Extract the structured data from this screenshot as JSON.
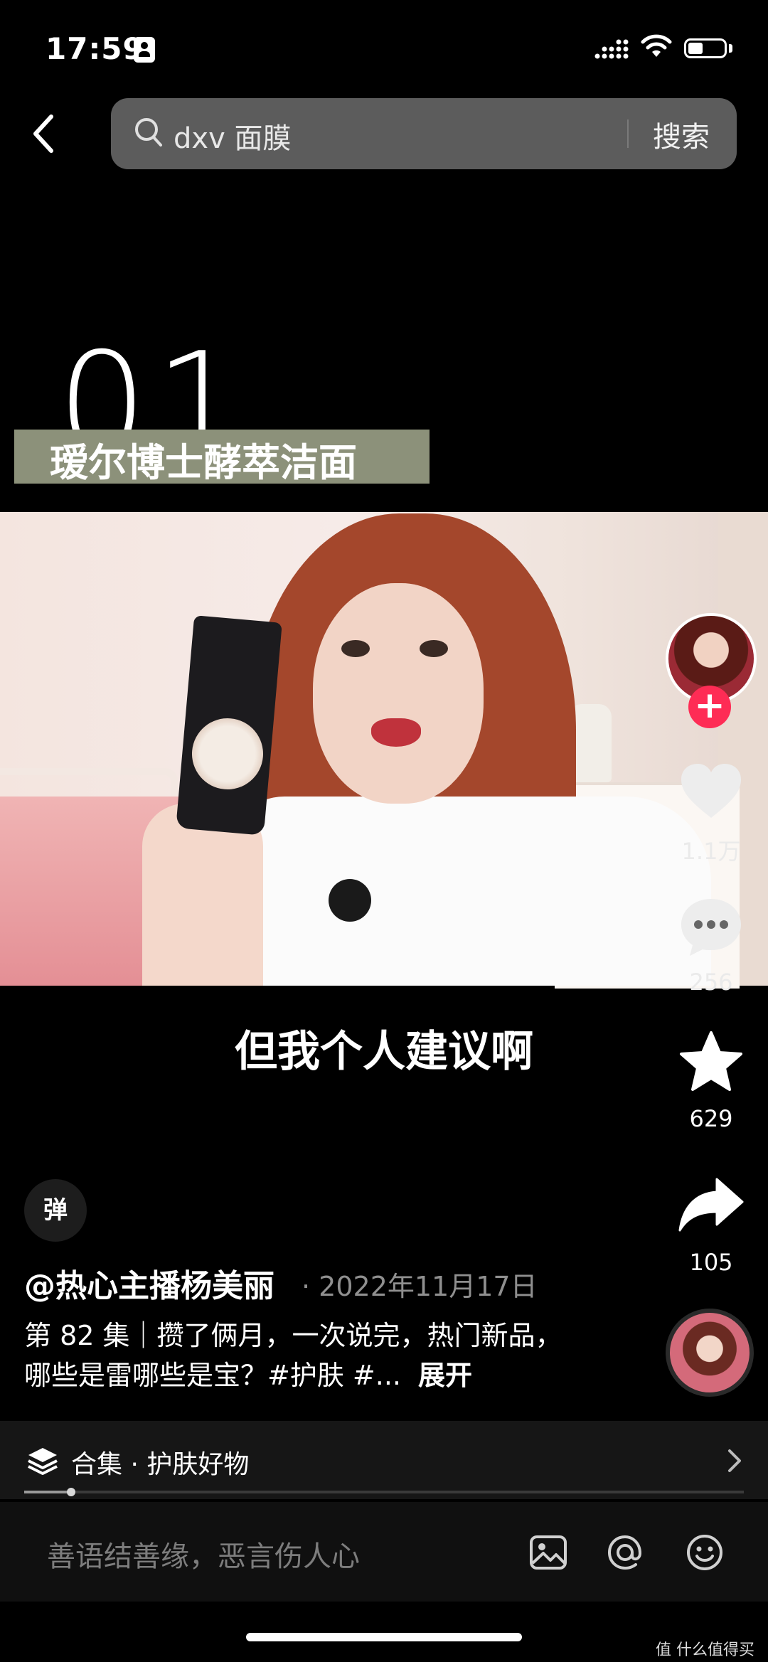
{
  "status_bar": {
    "time": "17:59"
  },
  "search": {
    "query": "dxv 面膜",
    "button_label": "搜索"
  },
  "video_overlay": {
    "number": "01",
    "caption": "瑷尔博士酵萃洁面",
    "subtitle": "但我个人建议啊"
  },
  "actions": {
    "likes": "1.1万",
    "comments": "256",
    "favorites": "629",
    "shares": "105"
  },
  "danmu_label": "弹",
  "post": {
    "author": "@热心主播杨美丽",
    "date": "· 2022年11月17日",
    "description": "第 82 集｜攒了俩月，一次说完，热门新品，哪些是雷哪些是宝？#护肤 #...",
    "expand_label": "展开"
  },
  "collection": {
    "label": "合集 · 护肤好物"
  },
  "comment_bar": {
    "placeholder": "善语结善缘，恶言伤人心"
  },
  "watermark": "值 什么值得买",
  "colors": {
    "follow_red": "#fe2c55",
    "background": "#000000"
  }
}
